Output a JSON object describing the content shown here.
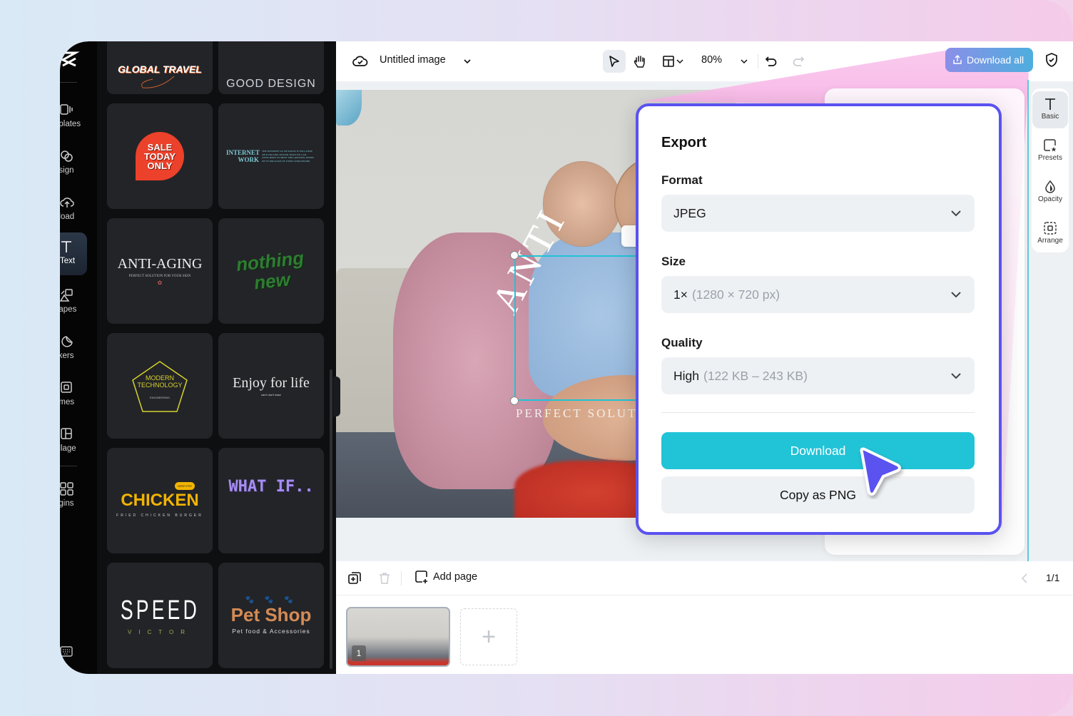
{
  "app": {
    "document_title": "Untitled image",
    "zoom_level": "80%",
    "download_all_label": "Download all"
  },
  "nav_rail": {
    "items": [
      {
        "id": "templates",
        "label": "nplates",
        "icon": "templates-icon"
      },
      {
        "id": "design",
        "label": "esign",
        "icon": "design-icon"
      },
      {
        "id": "upload",
        "label": "pload",
        "icon": "upload-icon"
      },
      {
        "id": "text",
        "label": "Text",
        "icon": "text-icon",
        "active": true
      },
      {
        "id": "shapes",
        "label": "napes",
        "icon": "shapes-icon"
      },
      {
        "id": "stickers",
        "label": "ckers",
        "icon": "stickers-icon"
      },
      {
        "id": "frames",
        "label": "ames",
        "icon": "frames-icon"
      },
      {
        "id": "collage",
        "label": "ollage",
        "icon": "collage-icon"
      },
      {
        "id": "plugins",
        "label": "ugins",
        "icon": "plugins-icon"
      }
    ]
  },
  "templates": [
    {
      "title": "GLOBAL TRAVEL",
      "sub": ""
    },
    {
      "title": "GOOD DESIGN",
      "sub": ""
    },
    {
      "title": "SALE TODAY ONLY",
      "sub": ""
    },
    {
      "title": "INTERNET WORK",
      "sub": "THE INTERNET AS WE KNOW IT WILL KEEP ON EVOLVING FASTER THAN WE CAN ANTICIPATE TO MEET THE GROWING NEEDS OF ITS BILLIONS OF USERS WORLDWIDE."
    },
    {
      "title": "ANTI-AGING",
      "sub": "PERFECT SOLUTION FOR YOUR SKIN"
    },
    {
      "title": "nothing new",
      "sub": ""
    },
    {
      "title": "MODERN TECHNOLOGY",
      "sub": "ENGINEERING"
    },
    {
      "title": "Enjoy for life",
      "sub": "can't don't ease"
    },
    {
      "title": "CHICKEN",
      "sub": "FRIED CHICKEN BURGER",
      "badge": "DEEP-FRY"
    },
    {
      "title": "WHAT IF..",
      "sub": ""
    },
    {
      "title": "SPEED",
      "sub": "VICTOR"
    },
    {
      "title": "Pet Shop",
      "sub": "Pet food & Accessories"
    }
  ],
  "canvas": {
    "headline": "ANTI",
    "subline": "PERFECT SOLUTI"
  },
  "properties_tabs": [
    {
      "label": "Basic",
      "icon": "text-t-icon",
      "active": true
    },
    {
      "label": "Presets",
      "icon": "presets-icon"
    },
    {
      "label": "Opacity",
      "icon": "opacity-icon"
    },
    {
      "label": "Arrange",
      "icon": "arrange-icon"
    }
  ],
  "export_dialog": {
    "title": "Export",
    "format_label": "Format",
    "format_value": "JPEG",
    "size_label": "Size",
    "size_value": "1×",
    "size_detail": "(1280 × 720 px)",
    "quality_label": "Quality",
    "quality_value": "High",
    "quality_detail": "(122 KB – 243 KB)",
    "download_label": "Download",
    "copy_label": "Copy as PNG"
  },
  "bottom_bar": {
    "add_page_label": "Add page",
    "page_indicator": "1/1"
  },
  "pages": [
    {
      "number": "1"
    }
  ],
  "colors": {
    "accent": "#21c3d7",
    "dialog_border": "#5a52f0",
    "cursor": "#5a52f0"
  }
}
